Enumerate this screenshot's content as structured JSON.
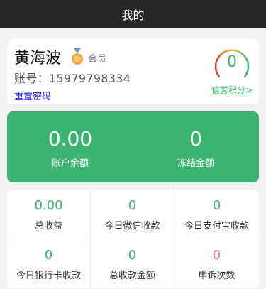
{
  "header": {
    "title": "我的"
  },
  "user": {
    "name": "黄海波",
    "badge_icon": "medal-icon",
    "member_label": "会员",
    "account_prefix": "账号：",
    "account_number": "15979798334",
    "reset_password": "重置密码"
  },
  "credit": {
    "score": "0",
    "link_label": "信誉积分>"
  },
  "balances": [
    {
      "value": "0.00",
      "label": "账户余额"
    },
    {
      "value": "0",
      "label": "冻结金额"
    }
  ],
  "stats": [
    {
      "value": "0.00",
      "label": "总收益"
    },
    {
      "value": "0",
      "label": "今日微信收款"
    },
    {
      "value": "0",
      "label": "今日支付宝收款"
    },
    {
      "value": "0",
      "label": "今日银行卡收款"
    },
    {
      "value": "0",
      "label": "总收款金额"
    },
    {
      "value": "0",
      "label": "申诉次数"
    }
  ],
  "colors": {
    "primary": "#3cb371",
    "header_bg": "#262626",
    "appeal_value": "#e77c8e"
  }
}
